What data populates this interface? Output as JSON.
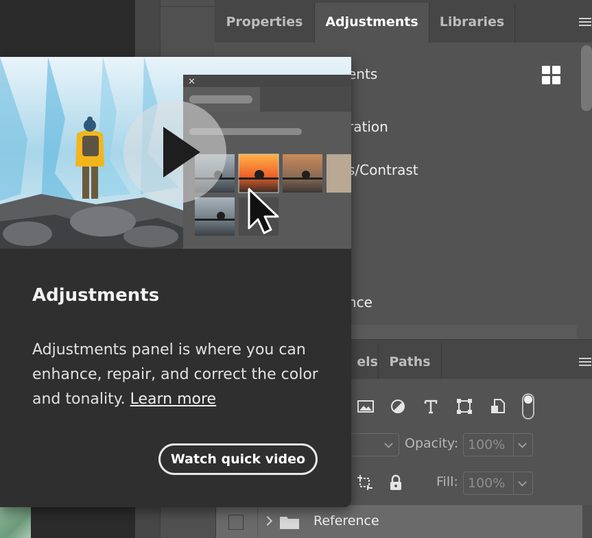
{
  "adjustments_panel": {
    "tabs": [
      "Properties",
      "Adjustments",
      "Libraries"
    ],
    "active_tab": "Adjustments",
    "rows_partial": [
      "ents",
      "ration",
      "s/Contrast",
      "nce"
    ]
  },
  "layers_panel": {
    "tabs_partial": [
      "els",
      "Paths"
    ],
    "opacity_label": "Opacity:",
    "opacity_value": "100%",
    "fill_label": "Fill:",
    "fill_value": "100%",
    "layer_name": "Reference"
  },
  "tooltip": {
    "title": "Adjustments",
    "body": "Adjustments panel is where you can enhance, repair, and correct the color and tonality.",
    "link_text": "Learn more",
    "button_label": "Watch quick video"
  },
  "icons": [
    "play-icon",
    "close-icon",
    "cursor-arrow-icon",
    "grid-icon",
    "menu-icon",
    "image-filter-icon",
    "adjustment-filter-icon",
    "type-filter-icon",
    "shape-filter-icon",
    "smart-object-filter-icon",
    "lock-position-icon",
    "lock-icon",
    "folder-icon",
    "chevron-right-icon"
  ],
  "colors": {
    "card_bg": "#2f2f2f",
    "panel_bg": "#535353",
    "accent_jacket": "#f2b51c"
  }
}
